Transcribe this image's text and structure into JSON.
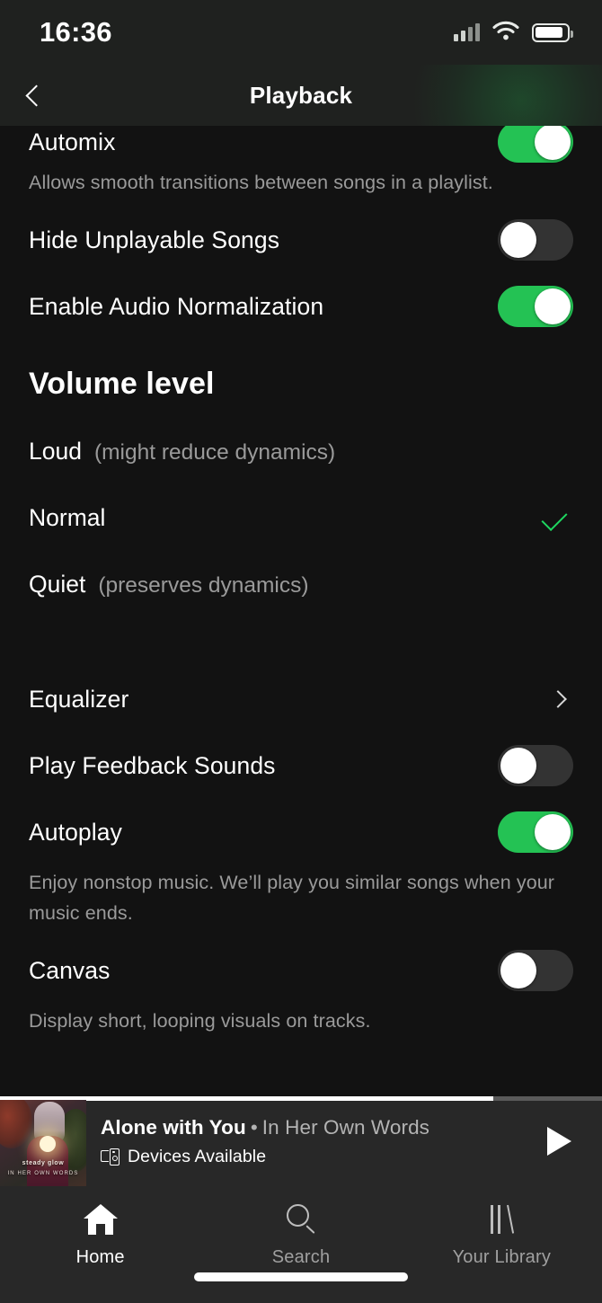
{
  "status_bar": {
    "time": "16:36",
    "signal_icon": "cellular-signal-icon",
    "wifi_icon": "wifi-icon",
    "battery_icon": "battery-icon"
  },
  "header": {
    "back_icon": "chevron-left-icon",
    "title": "Playback"
  },
  "settings": {
    "toggles_top": [
      {
        "label": "Automix",
        "state": "on",
        "description": "Allows smooth transitions between songs in a playlist."
      },
      {
        "label": "Hide Unplayable Songs",
        "state": "off",
        "description": ""
      },
      {
        "label": "Enable Audio Normalization",
        "state": "on",
        "description": ""
      }
    ],
    "volume_section": {
      "title": "Volume level",
      "options": [
        {
          "label": "Loud",
          "hint": "(might reduce dynamics)",
          "selected": false
        },
        {
          "label": "Normal",
          "hint": "",
          "selected": true
        },
        {
          "label": "Quiet",
          "hint": "(preserves dynamics)",
          "selected": false
        }
      ],
      "check_icon": "checkmark-icon",
      "check_color": "#1ed760"
    },
    "equalizer": {
      "label": "Equalizer",
      "chevron_icon": "chevron-right-icon"
    },
    "toggles_bottom": [
      {
        "label": "Play Feedback Sounds",
        "state": "off",
        "description": ""
      },
      {
        "label": "Autoplay",
        "state": "on",
        "description": "Enjoy nonstop music. We’ll play you similar songs when your music ends."
      },
      {
        "label": "Canvas",
        "state": "off",
        "description": "Display short, looping visuals on tracks."
      }
    ],
    "toggle_on_color": "#24c254",
    "toggle_off_color": "#333333"
  },
  "mini_player": {
    "album_art": {
      "icon": "album-art-thumbnail",
      "caption_line1": "steady glow",
      "caption_line2": "IN HER OWN WORDS"
    },
    "track_title": "Alone with You",
    "separator": "•",
    "artist": "In Her Own Words",
    "device_icon": "spotify-connect-devices-icon",
    "device_label": "Devices Available",
    "play_icon": "play-icon",
    "progress_percent": 82
  },
  "tab_bar": {
    "tabs": [
      {
        "label": "Home",
        "icon": "home-icon",
        "active": true
      },
      {
        "label": "Search",
        "icon": "search-icon",
        "active": false
      },
      {
        "label": "Your Library",
        "icon": "library-icon",
        "active": false
      }
    ]
  }
}
